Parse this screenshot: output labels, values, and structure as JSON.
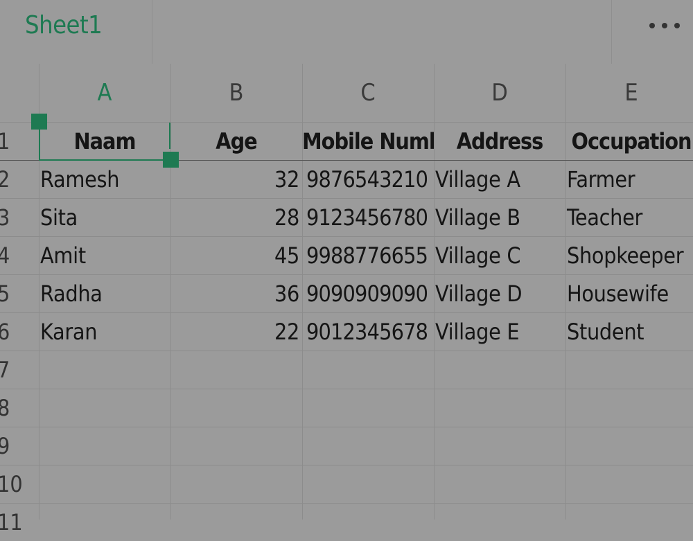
{
  "sheet_tab": {
    "label": "Sheet1"
  },
  "menu": {
    "more_icon": "more-horizontal-icon"
  },
  "columns": [
    "A",
    "B",
    "C",
    "D",
    "E"
  ],
  "rows": [
    "1",
    "2",
    "3",
    "4",
    "5",
    "6",
    "7",
    "8",
    "9",
    "10",
    "11"
  ],
  "header_row": [
    "Naam",
    "Age",
    "Mobile Number",
    "Address",
    "Occupation"
  ],
  "data_rows": [
    [
      "Ramesh",
      "32",
      "9876543210",
      "Village A",
      "Farmer"
    ],
    [
      "Sita",
      "28",
      "9123456780",
      "Village B",
      "Teacher"
    ],
    [
      "Amit",
      "45",
      "9988776655",
      "Village C",
      "Shopkeeper"
    ],
    [
      "Radha",
      "36",
      "9090909090",
      "Village D",
      "Housewife"
    ],
    [
      "Karan",
      "22",
      "9012345678",
      "Village E",
      "Student"
    ]
  ],
  "colors": {
    "accent": "#1e7a52",
    "background": "#9b9b9b"
  }
}
